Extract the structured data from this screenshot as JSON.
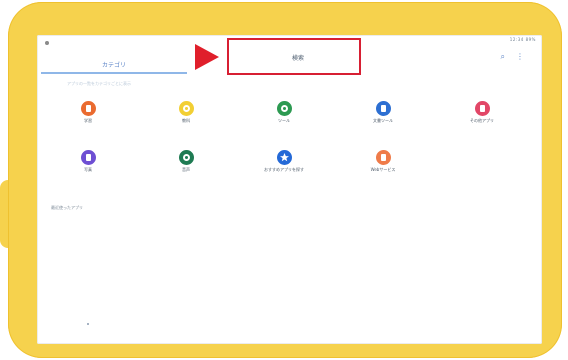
{
  "screen": {
    "status_right": "12:34  89%",
    "tab_category": "カテゴリ",
    "tab_category_sub": "アプリの一覧をカテゴリごとに表示",
    "tab_search": "検索",
    "top_right_icons": [
      "search-icon",
      "more-icon"
    ]
  },
  "apps": [
    {
      "label": "学習",
      "color": "#ea6b30",
      "icon": "book-icon"
    },
    {
      "label": "教科",
      "color": "#f2cf34",
      "icon": "smile-icon"
    },
    {
      "label": "ツール",
      "color": "#2d9a52",
      "icon": "grid-icon"
    },
    {
      "label": "文書ツール",
      "color": "#2d6fd2",
      "icon": "doc-icon"
    },
    {
      "label": "その他アプリ",
      "color": "#e24767",
      "icon": "gift-icon"
    },
    {
      "label": "写真",
      "color": "#6e4fd3",
      "icon": "camera-icon"
    },
    {
      "label": "音声",
      "color": "#1f7b53",
      "icon": "circle-icon"
    },
    {
      "label": "おすすめアプリを探す",
      "color": "#2469d7",
      "icon": "star-icon"
    },
    {
      "label": "Webサービス",
      "color": "#ef7b49",
      "icon": "web-icon"
    }
  ],
  "recent": {
    "label": "最近使ったアプリ"
  }
}
